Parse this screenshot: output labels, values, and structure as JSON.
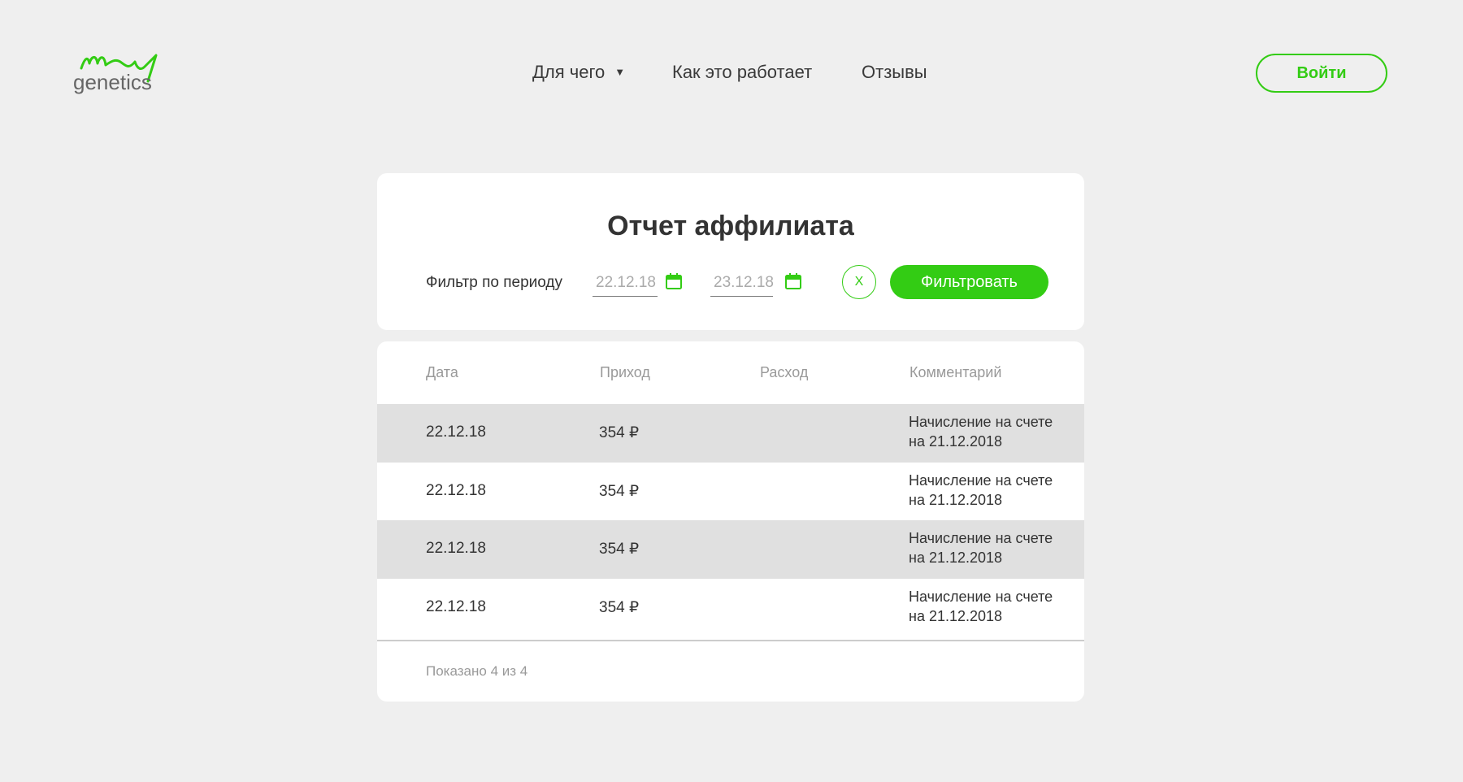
{
  "header": {
    "logo_text": "genetics",
    "nav": [
      {
        "label": "Для чего",
        "has_dropdown": true
      },
      {
        "label": "Как это работает",
        "has_dropdown": false
      },
      {
        "label": "Отзывы",
        "has_dropdown": false
      }
    ],
    "login_label": "Войти"
  },
  "filter": {
    "title": "Отчет аффилиата",
    "label": "Фильтр по периоду",
    "date_from_placeholder": "22.12.18",
    "date_to_placeholder": "23.12.18",
    "clear_label": "X",
    "submit_label": "Фильтровать"
  },
  "table": {
    "columns": [
      "Дата",
      "Приход",
      "Расход",
      "Комментарий"
    ],
    "rows": [
      {
        "date": "22.12.18",
        "income": "354 ₽",
        "expense": "",
        "comment": "Начисление на счете на 21.12.2018"
      },
      {
        "date": "22.12.18",
        "income": "354 ₽",
        "expense": "",
        "comment": "Начисление на счете на 21.12.2018"
      },
      {
        "date": "22.12.18",
        "income": "354 ₽",
        "expense": "",
        "comment": "Начисление на счете на 21.12.2018"
      },
      {
        "date": "22.12.18",
        "income": "354 ₽",
        "expense": "",
        "comment": "Начисление на счете на 21.12.2018"
      }
    ],
    "shown_text": "Показано 4 из 4"
  },
  "colors": {
    "accent": "#33cc14",
    "background": "#efefef",
    "row_shade": "#e0e0e0"
  }
}
